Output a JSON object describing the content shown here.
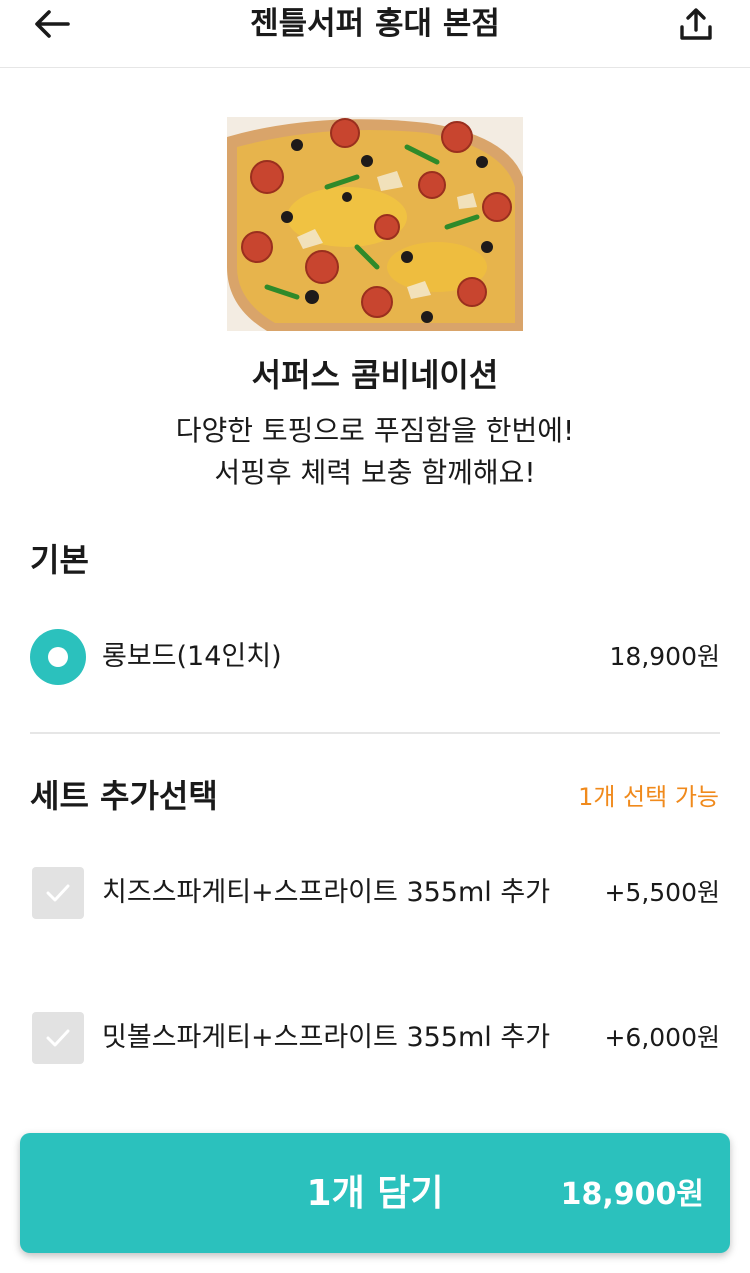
{
  "header": {
    "title": "젠틀서퍼 홍대 본점",
    "back_icon": "arrow-left-icon",
    "share_icon": "share-upload-icon"
  },
  "product": {
    "image": "pizza-photo",
    "name": "서퍼스 콤비네이션",
    "description_lines": [
      "다양한 토핑으로 푸짐함을 한번에!",
      "서핑후 체력 보충 함께해요!"
    ]
  },
  "basic_section": {
    "title": "기본",
    "options": [
      {
        "label": "롱보드(14인치)",
        "price": "18,900원",
        "selected": true
      }
    ]
  },
  "set_section": {
    "title": "세트 추가선택",
    "note": "1개 선택 가능",
    "options": [
      {
        "label": "치즈스파게티+스프라이트 355ml 추가",
        "price": "+5,500원",
        "checked": false
      },
      {
        "label": "밋볼스파게티+스프라이트 355ml 추가",
        "price": "+6,000원",
        "checked": false
      }
    ]
  },
  "cta": {
    "label": "1개 담기",
    "price": "18,900원"
  },
  "colors": {
    "accent": "#2bc1bd",
    "note": "#f08a1c",
    "checkbox_bg": "#e2e2e2",
    "divider": "#e6e6e6"
  }
}
